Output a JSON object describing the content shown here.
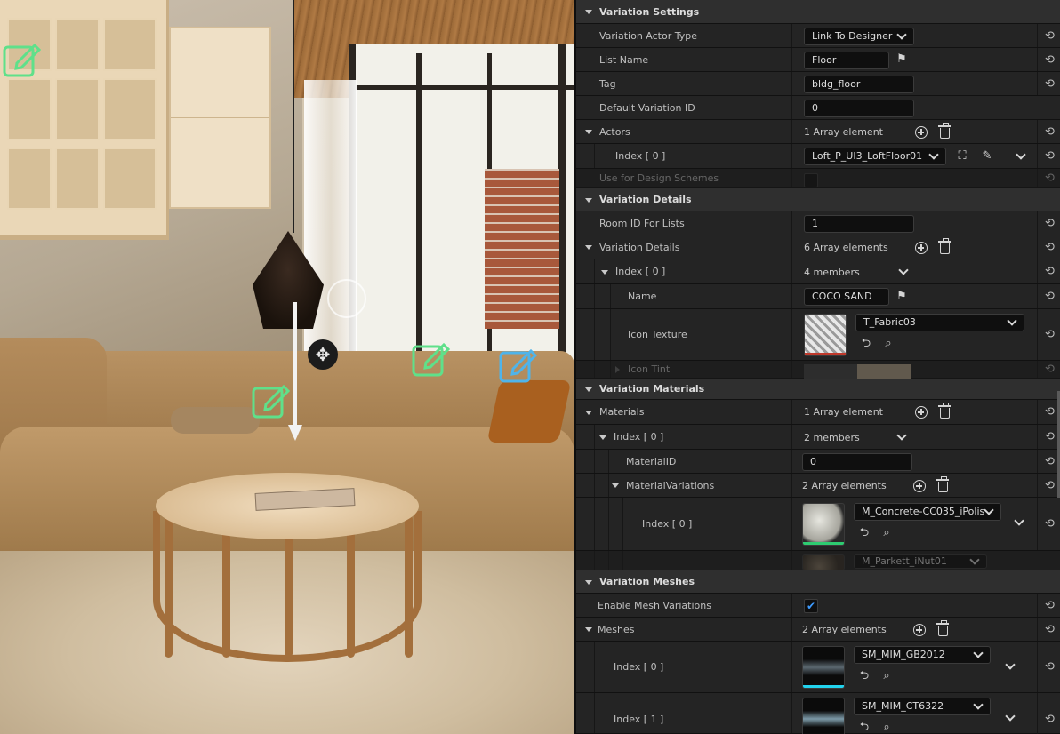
{
  "viewport": {
    "edit_icon_color_green": "#5fe08a",
    "edit_icon_color_blue": "#4fb4ea"
  },
  "panel": {
    "variation_settings": {
      "header": "Variation Settings",
      "actor_type_label": "Variation Actor Type",
      "actor_type_value": "Link To Designer",
      "list_name_label": "List Name",
      "list_name_value": "Floor",
      "tag_label": "Tag",
      "tag_value": "bldg_floor",
      "default_id_label": "Default Variation ID",
      "default_id_value": "0",
      "actors_label": "Actors",
      "actors_count": "1 Array element",
      "actor_index_label": "Index [ 0 ]",
      "actor_index_value": "Loft_P_UI3_LoftFloor01",
      "design_schemes_label": "Use for Design Schemes"
    },
    "variation_details": {
      "header": "Variation Details",
      "room_id_label": "Room ID For Lists",
      "room_id_value": "1",
      "details_label": "Variation Details",
      "details_count": "6 Array elements",
      "index0_label": "Index [ 0 ]",
      "index0_members": "4 members",
      "name_label": "Name",
      "name_value": "COCO SAND",
      "icon_texture_label": "Icon Texture",
      "icon_texture_value": "T_Fabric03",
      "icon_tint_label": "Icon Tint"
    },
    "variation_materials": {
      "header": "Variation Materials",
      "materials_label": "Materials",
      "materials_count": "1 Array element",
      "index0_label": "Index [ 0 ]",
      "index0_members": "2 members",
      "material_id_label": "MaterialID",
      "material_id_value": "0",
      "mat_variations_label": "MaterialVariations",
      "mat_variations_count": "2 Array elements",
      "mv_index0_label": "Index [ 0 ]",
      "mv_index0_value": "M_Concrete-CC035_iPolis",
      "mv_index1_value": "M_Parkett_iNut01"
    },
    "variation_meshes": {
      "header": "Variation Meshes",
      "enable_label": "Enable Mesh Variations",
      "enable_checked": "✔",
      "meshes_label": "Meshes",
      "meshes_count": "2 Array elements",
      "mesh0_label": "Index [ 0 ]",
      "mesh0_value": "SM_MIM_GB2012",
      "mesh1_label": "Index [ 1 ]",
      "mesh1_value": "SM_MIM_CT6322"
    },
    "icons": {
      "reset": "⟲",
      "flag": "⚑",
      "browse": "⌕",
      "use_selected": "⮌",
      "picker": "✎"
    },
    "accent_colors": {
      "checkbox": "#3d9bff",
      "thumb_red": "#c0392b",
      "thumb_green": "#2ecc71",
      "thumb_cyan": "#22d3ee"
    }
  }
}
